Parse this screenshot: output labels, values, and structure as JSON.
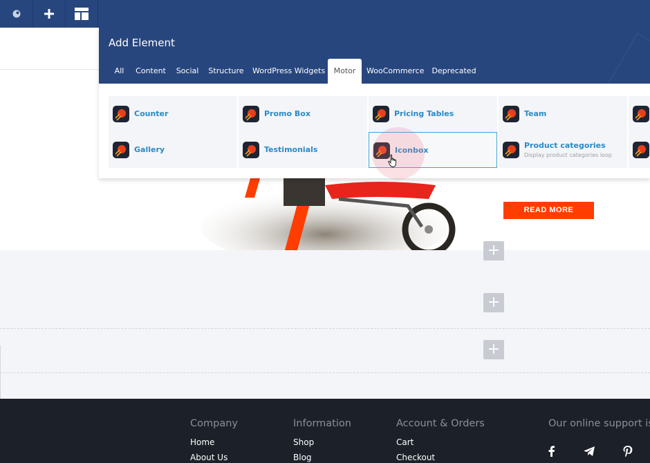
{
  "toolbar": {
    "items": [
      {
        "icon": "composer-logo-icon"
      },
      {
        "icon": "plus-icon"
      },
      {
        "icon": "layout-icon"
      }
    ]
  },
  "panel": {
    "title": "Add Element",
    "tabs": [
      {
        "label": "All"
      },
      {
        "label": "Content"
      },
      {
        "label": "Social"
      },
      {
        "label": "Structure"
      },
      {
        "label": "WordPress Widgets"
      },
      {
        "label": "Motor",
        "active": true
      },
      {
        "label": "WooCommerce"
      },
      {
        "label": "Deprecated"
      }
    ],
    "elements": [
      {
        "label": "Counter",
        "icon": "motor-element-icon"
      },
      {
        "label": "Promo Box",
        "icon": "motor-element-icon"
      },
      {
        "label": "Pricing Tables",
        "icon": "motor-element-icon"
      },
      {
        "label": "Team",
        "icon": "motor-element-icon"
      },
      {
        "label": "",
        "icon": "motor-element-icon"
      },
      {
        "label": "Gallery",
        "icon": "motor-element-icon"
      },
      {
        "label": "Testimonials",
        "icon": "motor-element-icon"
      },
      {
        "label": "Iconbox",
        "icon": "motor-element-icon",
        "hovered": true
      },
      {
        "label": "Product categories",
        "description": "Display product categories loop",
        "icon": "motor-element-icon"
      },
      {
        "label": "",
        "icon": "motor-element-icon"
      }
    ]
  },
  "page": {
    "read_more": "READ MORE",
    "add_row_icon": "+"
  },
  "footer": {
    "columns": [
      {
        "heading": "Company",
        "links": [
          "Home",
          "About Us"
        ]
      },
      {
        "heading": "Information",
        "links": [
          "Shop",
          "Blog"
        ]
      },
      {
        "heading": "Account & Orders",
        "links": [
          "Cart",
          "Checkout"
        ]
      },
      {
        "heading": "Our online support is",
        "links": []
      }
    ],
    "social": [
      "facebook-icon",
      "telegram-icon",
      "pinterest-icon"
    ]
  },
  "colors": {
    "header_blue": "#28467e",
    "link_blue": "#2a8ac6",
    "accent_orange": "#ff3d00",
    "footer_dark": "#1b2029"
  }
}
